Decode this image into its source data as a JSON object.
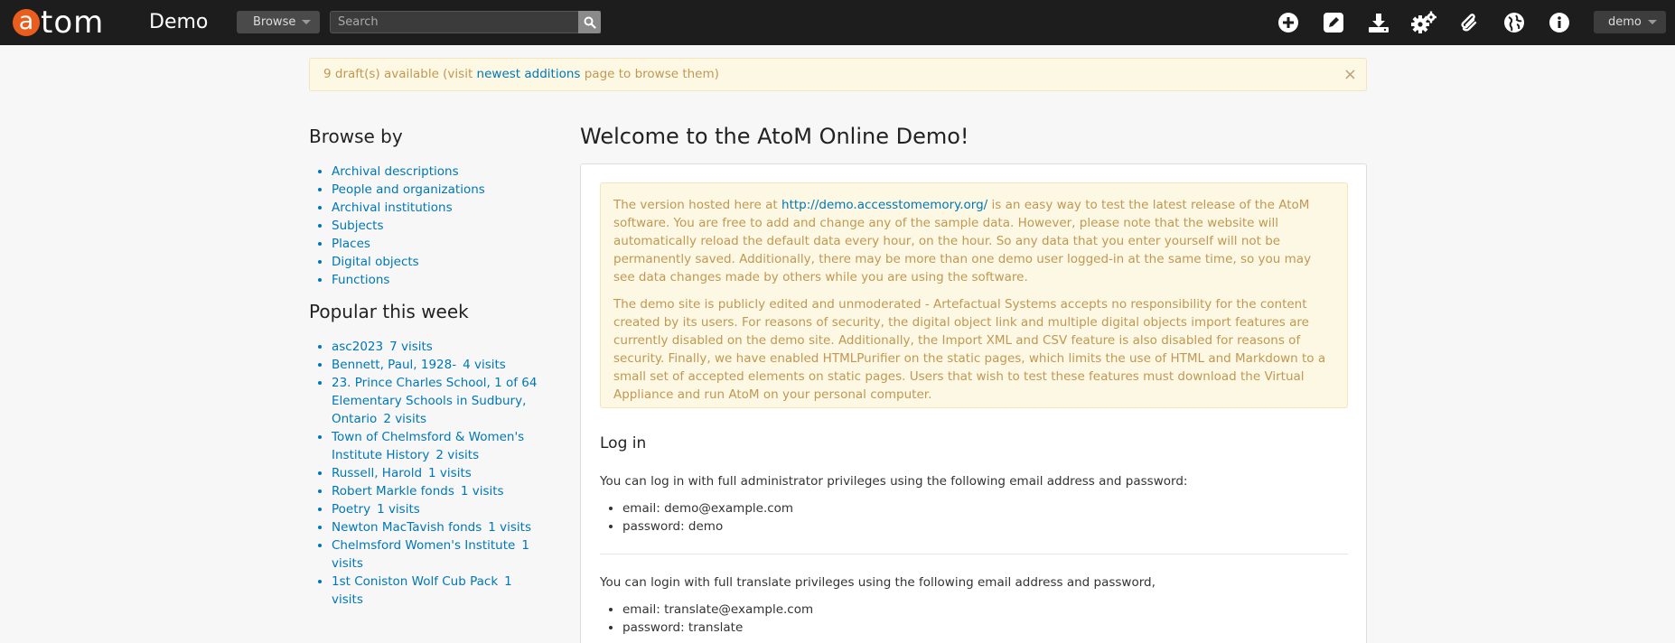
{
  "topbar": {
    "logo_letter": "a",
    "logo_text": "tom",
    "site_name": "Demo",
    "browse_label": "Browse",
    "search_placeholder": "Search",
    "icons": [
      "add-icon",
      "edit-icon",
      "import-icon",
      "settings-icon",
      "clipboard-icon",
      "language-icon",
      "info-icon"
    ],
    "user_label": "demo"
  },
  "alert": {
    "text_before": "9 draft(s) available (visit ",
    "link_text": "newest additions",
    "text_after": " page to browse them)",
    "close": "×"
  },
  "browse_by": {
    "heading": "Browse by",
    "items": [
      "Archival descriptions",
      "People and organizations",
      "Archival institutions",
      "Subjects",
      "Places",
      "Digital objects",
      "Functions"
    ]
  },
  "popular": {
    "heading": "Popular this week",
    "items": [
      {
        "title": "asc2023",
        "visits": "7 visits"
      },
      {
        "title": "Bennett, Paul, 1928-",
        "visits": "4 visits"
      },
      {
        "title": "23. Prince Charles School, 1 of 64 Elementary Schools in Sudbury, Ontario",
        "visits": "2 visits"
      },
      {
        "title": "Town of Chelmsford & Women's Institute History",
        "visits": "2 visits"
      },
      {
        "title": "Russell, Harold",
        "visits": "1 visits"
      },
      {
        "title": "Robert Markle fonds",
        "visits": "1 visits"
      },
      {
        "title": "Poetry",
        "visits": "1 visits"
      },
      {
        "title": "Newton MacTavish fonds",
        "visits": "1 visits"
      },
      {
        "title": "Chelmsford Women's Institute",
        "visits": "1 visits"
      },
      {
        "title": "1st Coniston Wolf Cub Pack",
        "visits": "1 visits"
      }
    ]
  },
  "main": {
    "title": "Welcome to the AtoM Online Demo!",
    "notice_p1_before": "The version hosted here at ",
    "notice_p1_link": "http://demo.accesstomemory.org/",
    "notice_p1_after": " is an easy way to test the latest release of the AtoM software. You are free to add and change any of the sample data. However, please note that the website will automatically reload the default data every hour, on the hour. So any data that you enter yourself will not be permanently saved. Additionally, there may be more than one demo user logged-in at the same time, so you may see data changes made by others while you are using the software.",
    "notice_p2": "The demo site is publicly edited and unmoderated - Artefactual Systems accepts no responsibility for the content created by its users. For reasons of security, the digital object link and multiple digital objects import features are currently disabled on the demo site. Additionally, the Import XML and CSV feature is also disabled for reasons of security. Finally, we have enabled HTMLPurifier on the static pages, which limits the use of HTML and Markdown to a small set of accepted elements on static pages. Users that wish to test these features must download the Virtual Appliance and run AtoM on your personal computer.",
    "login_heading": "Log in",
    "admin_text": "You can log in with full administrator privileges using the following email address and password:",
    "admin_email": "email: demo@example.com",
    "admin_password": "password: demo",
    "translate_text": "You can login with full translate privileges using the following email address and password,",
    "translate_email": "email: translate@example.com",
    "translate_password": "password: translate"
  },
  "colors": {
    "topbar_bg": "#1d1d1d",
    "logo_orange": "#e95d1d",
    "link": "#0077b5",
    "warning_text": "#c09853",
    "warning_bg": "#fcf8e3"
  }
}
